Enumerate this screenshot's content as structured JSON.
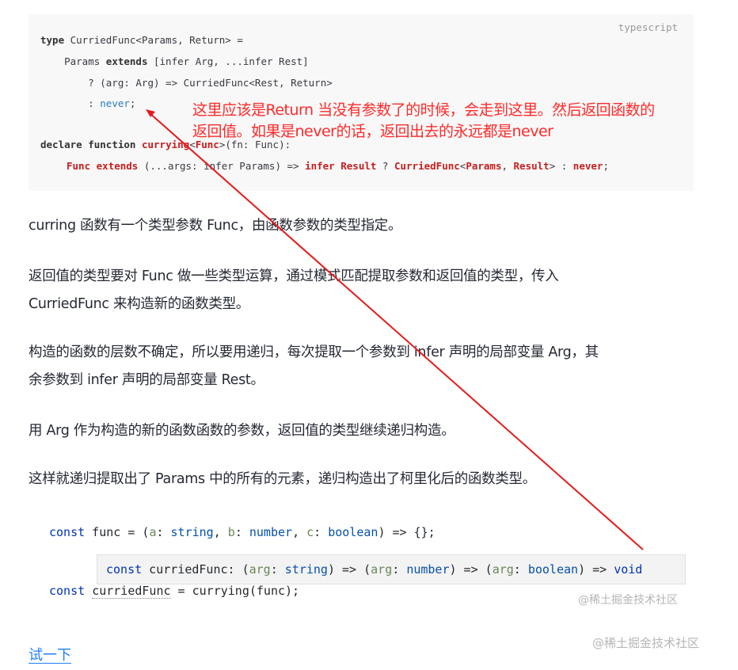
{
  "code_block": {
    "language": "typescript",
    "line1": {
      "kw": "type",
      "rest": " CurriedFunc<Params, Return> ="
    },
    "line2": {
      "pre": "    Params ",
      "kw": "extends",
      "rest": " [infer Arg, ...infer Rest]"
    },
    "line3": {
      "text": "        ? (arg: Arg) => CurriedFunc<Rest, Return>"
    },
    "line4": {
      "pre": "        : ",
      "never": "never",
      "semi": ";"
    },
    "line5": {
      "kw1": "declare",
      "kw2": "function",
      "fn": "currying",
      "rest_lt": "<",
      "func_type": "Func",
      "rest": ">(fn: Func):"
    },
    "line6": {
      "t1": "Func",
      "t2": "extends",
      "t3": " (...args: ",
      "t4": "infer",
      "t5": " Params) => ",
      "t6": "infer",
      "t7": " Result",
      "t8": " ? ",
      "t9": "CurriedFunc",
      "t10": "<",
      "t11": "Params",
      "t12": ", ",
      "t13": "Result",
      "t14": "> : ",
      "t15": "never",
      "t16": ";"
    }
  },
  "annotation": {
    "line1": "这里应该是Return 当没有参数了的时候，会走到这里。然后返回函数的",
    "line2": "返回值。如果是never的话，返回出去的永远都是never",
    "color": "#ff2a2a"
  },
  "paragraphs": {
    "p1": "curring 函数有一个类型参数 Func，由函数参数的类型指定。",
    "p2a": "返回值的类型要对 Func 做一些类型运算，通过模式匹配提取参数和返回值的类型，传入",
    "p2b": "CurriedFunc 来构造新的函数类型。",
    "p3a": "构造的函数的层数不确定，所以要用递归，每次提取一个参数到 infer 声明的局部变量 Arg，其",
    "p3b": "余参数到 infer 声明的局部变量 Rest。",
    "p4": "用 Arg 作为构造的新的函数函数的参数，返回值的类型继续递归构造。",
    "p5": "这样就递归提取出了 Params 中的所有的元素，递归构造出了柯里化后的函数类型。"
  },
  "code_example": {
    "l1": {
      "k": "const",
      "a": " func = (",
      "p1": "a",
      "c1": ": ",
      "t1": "string",
      "s1": ", ",
      "p2": "b",
      "c2": ": ",
      "t2": "number",
      "s2": ", ",
      "p3": "c",
      "c3": ": ",
      "t3": "boolean",
      "end": ") => {};"
    },
    "l2": {
      "k": "const",
      "v": "curriedFunc",
      "rest": " = currying(func);"
    }
  },
  "tooltip": {
    "k": "const",
    "name": " curriedFunc: (",
    "a1": "arg",
    "c1": ": ",
    "t1": "string",
    "m1": ") => (",
    "a2": "arg",
    "c2": ": ",
    "t2": "number",
    "m2": ") => (",
    "a3": "arg",
    "c3": ": ",
    "t3": "boolean",
    "m3": ") => ",
    "t4": "void"
  },
  "watermarks": {
    "inner": "@稀土掘金技术社区",
    "outer": "@稀土掘金技术社区"
  },
  "try_link": "试一下",
  "colors": {
    "arrow": "#e41b1b",
    "link": "#1e80ff",
    "code_bg": "#f8f8f8"
  }
}
